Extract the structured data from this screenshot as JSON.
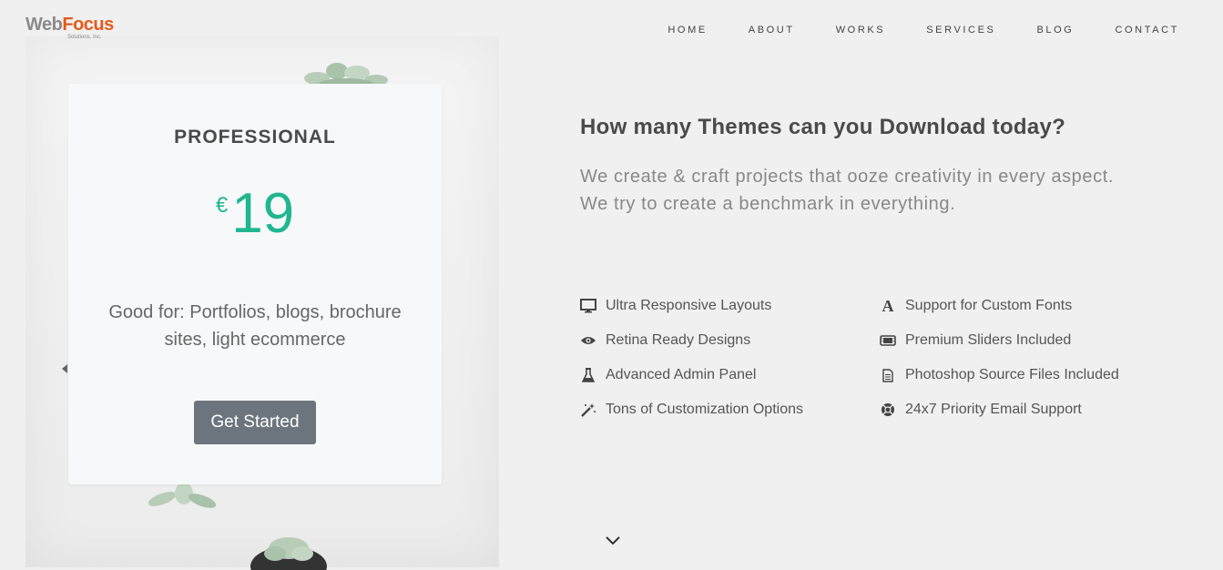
{
  "logo": {
    "web": "Web",
    "focus": "Focus",
    "sub": "Solutions, Inc."
  },
  "nav": [
    "HOME",
    "ABOUT",
    "WORKS",
    "SERVICES",
    "BLOG",
    "CONTACT"
  ],
  "pricing": {
    "plan": "PROFESSIONAL",
    "currency": "€",
    "amount": "19",
    "description": "Good for: Portfolios, blogs, brochure sites, light ecommerce",
    "cta": "Get Started"
  },
  "headline": "How many Themes can you Download today?",
  "subline": [
    "We create & craft projects that ooze creativity in every aspect.",
    "We try to create a benchmark in everything."
  ],
  "features_left": [
    {
      "icon": "monitor-icon",
      "label": "Ultra Responsive Layouts"
    },
    {
      "icon": "eye-icon",
      "label": "Retina Ready Designs"
    },
    {
      "icon": "flask-icon",
      "label": "Advanced Admin Panel"
    },
    {
      "icon": "magic-wand-icon",
      "label": "Tons of Customization Options"
    }
  ],
  "features_right": [
    {
      "icon": "font-icon",
      "label": "Support for Custom Fonts"
    },
    {
      "icon": "film-icon",
      "label": "Premium Sliders Included"
    },
    {
      "icon": "document-icon",
      "label": "Photoshop Source Files Included"
    },
    {
      "icon": "lifebuoy-icon",
      "label": "24x7 Priority Email Support"
    }
  ],
  "colors": {
    "accent": "#1fb690",
    "button": "#6c757d",
    "logo_orange": "#e55a1a"
  }
}
